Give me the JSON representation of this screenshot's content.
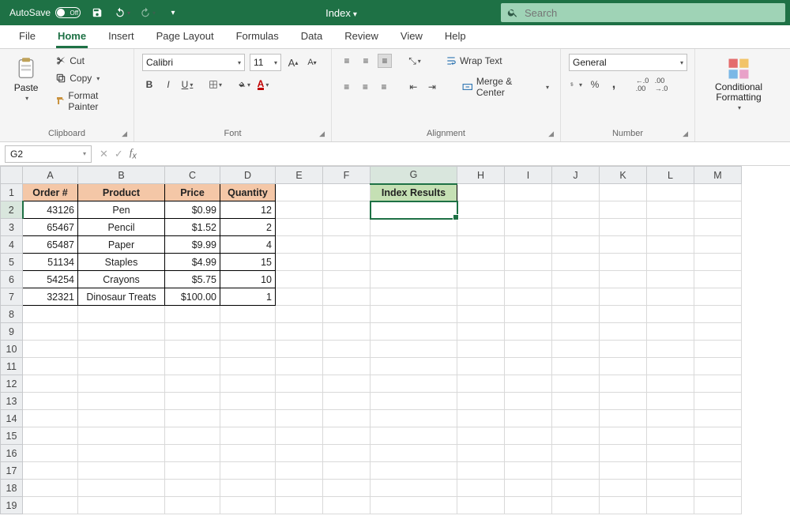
{
  "titlebar": {
    "autosave_label": "AutoSave",
    "autosave_state": "Off",
    "doc_name": "Index"
  },
  "search": {
    "placeholder": "Search"
  },
  "tabs": [
    "File",
    "Home",
    "Insert",
    "Page Layout",
    "Formulas",
    "Data",
    "Review",
    "View",
    "Help"
  ],
  "active_tab": "Home",
  "ribbon": {
    "clipboard": {
      "paste": "Paste",
      "cut": "Cut",
      "copy": "Copy",
      "format_painter": "Format Painter",
      "label": "Clipboard"
    },
    "font": {
      "name": "Calibri",
      "size": "11",
      "label": "Font",
      "bold": "B",
      "italic": "I",
      "underline": "U"
    },
    "alignment": {
      "wrap": "Wrap Text",
      "merge": "Merge & Center",
      "label": "Alignment"
    },
    "number": {
      "format": "General",
      "label": "Number",
      "percent": "%",
      "comma": ",",
      "inc": ".0₀",
      "dec": "₀.0"
    },
    "cond": {
      "label": "Conditional Formatting"
    }
  },
  "namebox": "G2",
  "columns": [
    "A",
    "B",
    "C",
    "D",
    "E",
    "F",
    "G",
    "H",
    "I",
    "J",
    "K",
    "L",
    "M"
  ],
  "rows": 19,
  "headers": {
    "A": "Order #",
    "B": "Product",
    "C": "Price",
    "D": "Quantity",
    "G": "Index Results"
  },
  "data_rows": [
    {
      "A": "43126",
      "B": "Pen",
      "C": "$0.99",
      "D": "12"
    },
    {
      "A": "65467",
      "B": "Pencil",
      "C": "$1.52",
      "D": "2"
    },
    {
      "A": "65487",
      "B": "Paper",
      "C": "$9.99",
      "D": "4"
    },
    {
      "A": "51134",
      "B": "Staples",
      "C": "$4.99",
      "D": "15"
    },
    {
      "A": "54254",
      "B": "Crayons",
      "C": "$5.75",
      "D": "10"
    },
    {
      "A": "32321",
      "B": "Dinosaur Treats",
      "C": "$100.00",
      "D": "1"
    }
  ],
  "selected_cell": "G2"
}
